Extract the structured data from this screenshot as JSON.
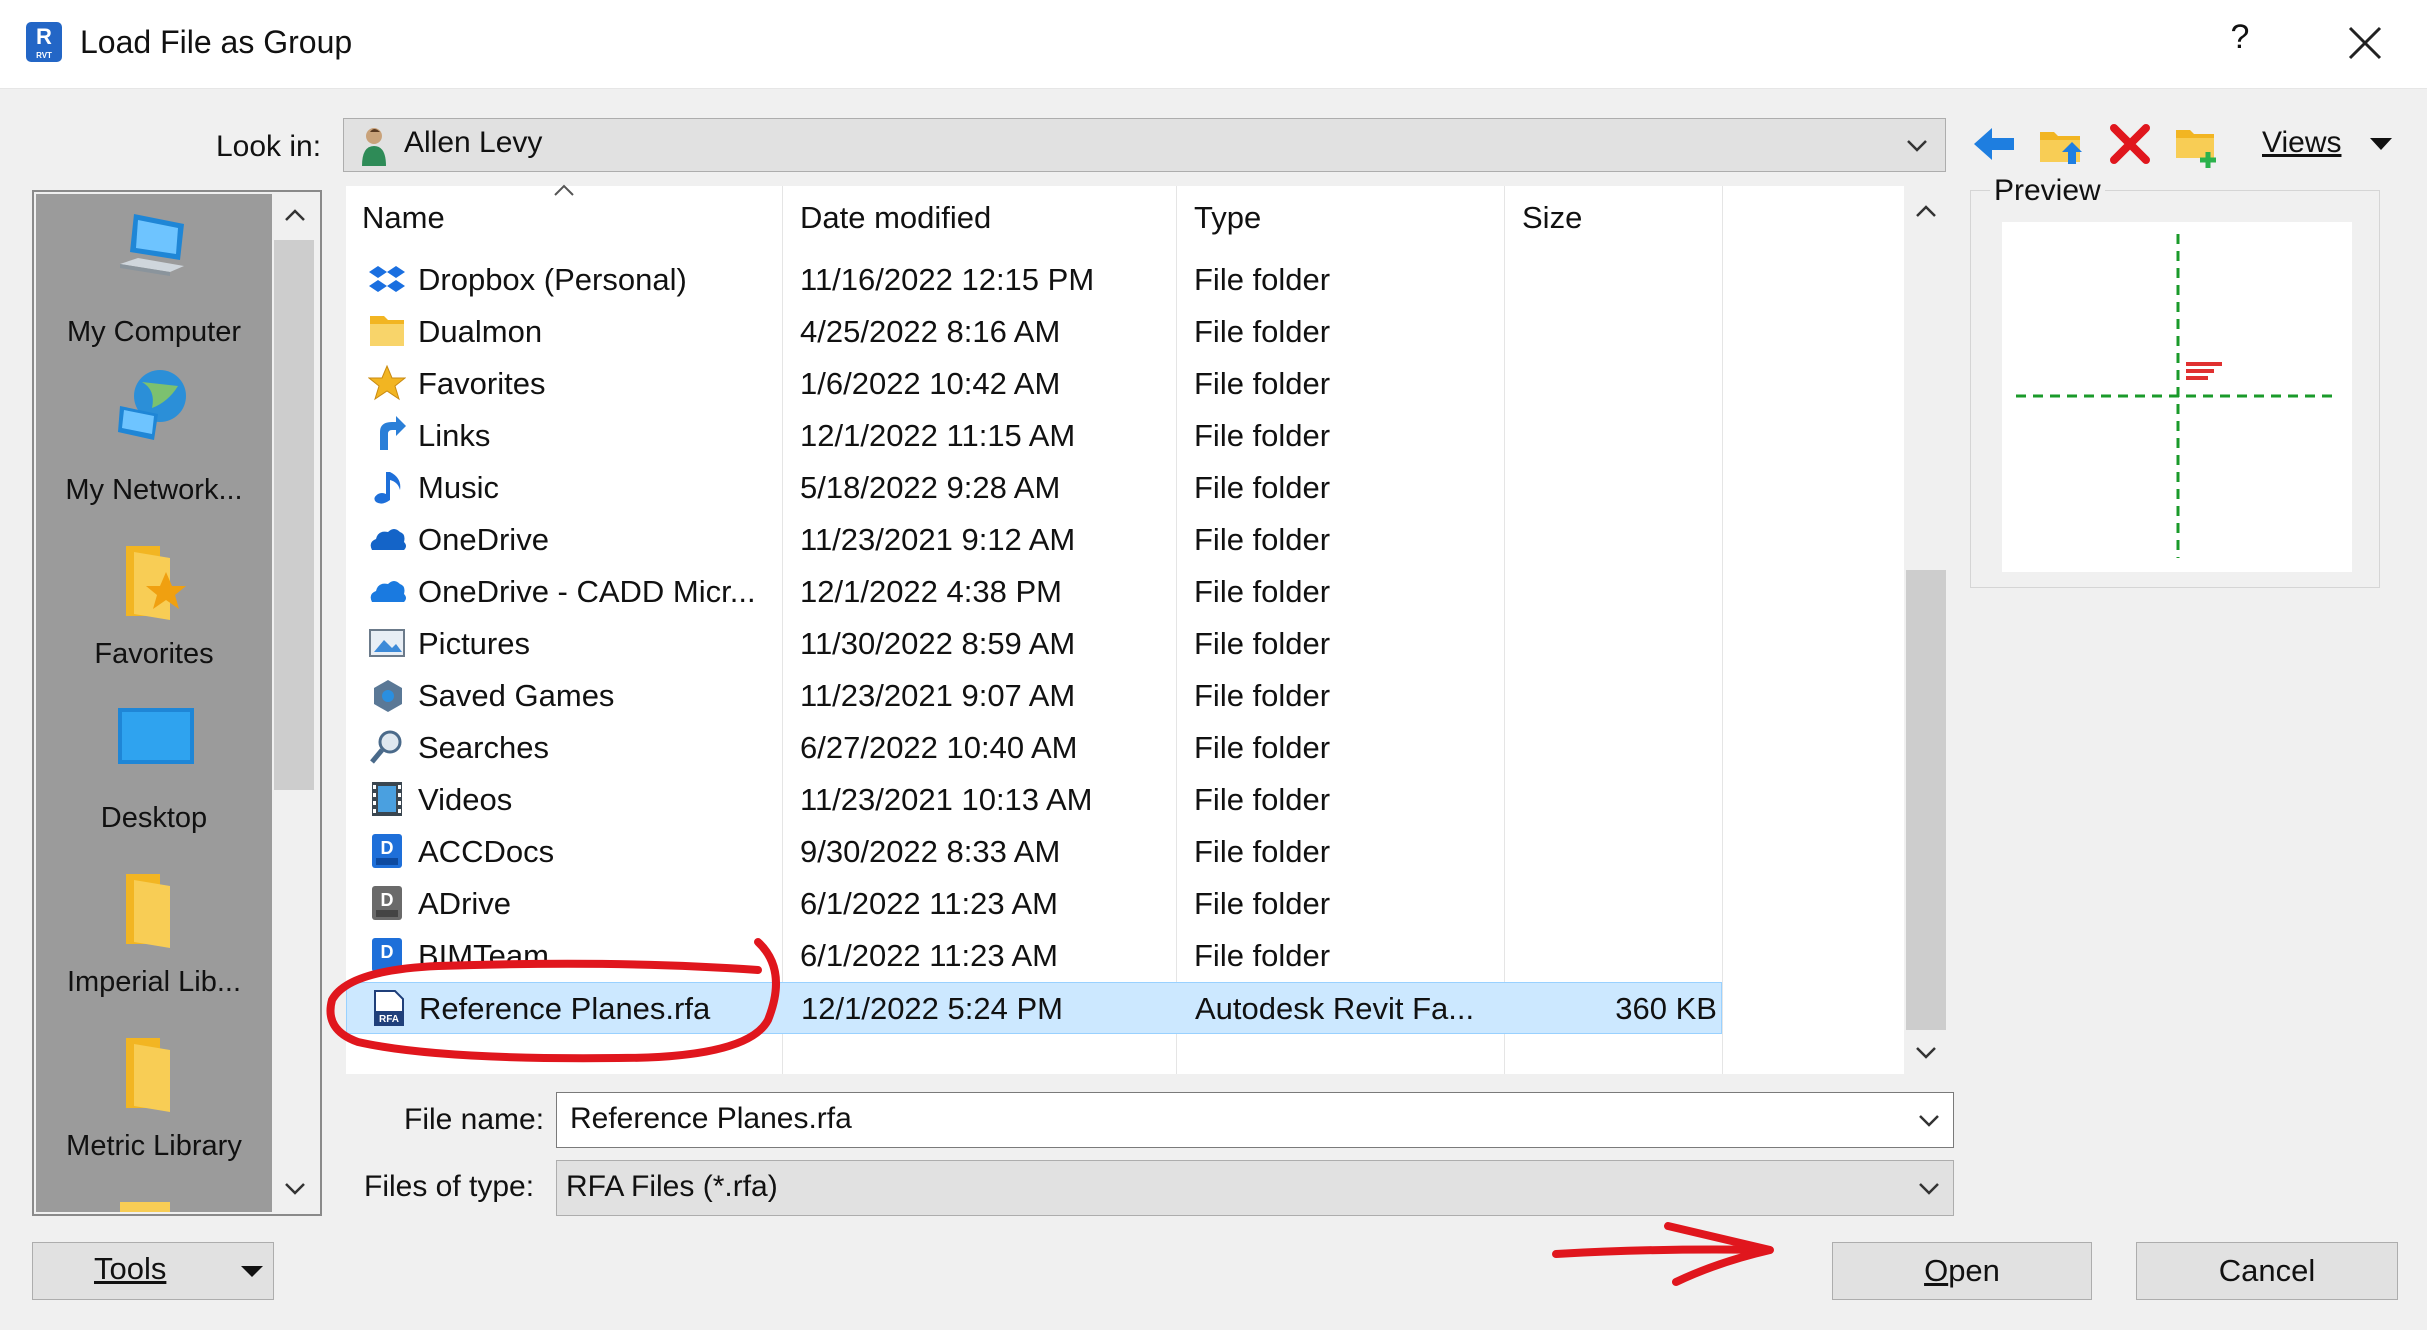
{
  "window": {
    "title": "Load File as Group",
    "app_icon_letter": "R",
    "app_icon_sub": "RVT",
    "help_label": "?",
    "close_icon": "close-icon"
  },
  "lookin": {
    "label": "Look in:",
    "value": "Allen Levy"
  },
  "toolbar": {
    "back_icon": "back-arrow-icon",
    "up_folder_icon": "up-one-level-icon",
    "delete_icon": "delete-icon",
    "new_folder_icon": "new-folder-icon",
    "views_label": "Views"
  },
  "places": [
    {
      "label": "My Computer",
      "icon": "computer-icon"
    },
    {
      "label": "My Network...",
      "icon": "network-icon"
    },
    {
      "label": "Favorites",
      "icon": "favorites-folder-icon"
    },
    {
      "label": "Desktop",
      "icon": "desktop-icon"
    },
    {
      "label": "Imperial Lib...",
      "icon": "folder-icon"
    },
    {
      "label": "Metric Library",
      "icon": "folder-icon"
    }
  ],
  "columns": {
    "name": "Name",
    "date": "Date modified",
    "type": "Type",
    "size": "Size"
  },
  "files": [
    {
      "name": "Dropbox (Personal)",
      "date": "11/16/2022 12:15 PM",
      "type": "File folder",
      "size": "",
      "icon": "dropbox-icon"
    },
    {
      "name": "Dualmon",
      "date": "4/25/2022 8:16 AM",
      "type": "File folder",
      "size": "",
      "icon": "folder-icon"
    },
    {
      "name": "Favorites",
      "date": "1/6/2022 10:42 AM",
      "type": "File folder",
      "size": "",
      "icon": "star-icon"
    },
    {
      "name": "Links",
      "date": "12/1/2022 11:15 AM",
      "type": "File folder",
      "size": "",
      "icon": "link-arrow-icon"
    },
    {
      "name": "Music",
      "date": "5/18/2022 9:28 AM",
      "type": "File folder",
      "size": "",
      "icon": "music-note-icon"
    },
    {
      "name": "OneDrive",
      "date": "11/23/2021 9:12 AM",
      "type": "File folder",
      "size": "",
      "icon": "onedrive-cloud-icon"
    },
    {
      "name": "OneDrive - CADD Micr...",
      "date": "12/1/2022 4:38 PM",
      "type": "File folder",
      "size": "",
      "icon": "onedrive-business-icon"
    },
    {
      "name": "Pictures",
      "date": "11/30/2022 8:59 AM",
      "type": "File folder",
      "size": "",
      "icon": "pictures-icon"
    },
    {
      "name": "Saved Games",
      "date": "11/23/2021 9:07 AM",
      "type": "File folder",
      "size": "",
      "icon": "saved-games-icon"
    },
    {
      "name": "Searches",
      "date": "6/27/2022 10:40 AM",
      "type": "File folder",
      "size": "",
      "icon": "search-icon"
    },
    {
      "name": "Videos",
      "date": "11/23/2021 10:13 AM",
      "type": "File folder",
      "size": "",
      "icon": "film-icon"
    },
    {
      "name": "ACCDocs",
      "date": "9/30/2022 8:33 AM",
      "type": "File folder",
      "size": "",
      "icon": "accdocs-drive-icon"
    },
    {
      "name": "ADrive",
      "date": "6/1/2022 11:23 AM",
      "type": "File folder",
      "size": "",
      "icon": "adrive-icon"
    },
    {
      "name": "BIMTeam",
      "date": "6/1/2022 11:23 AM",
      "type": "File folder",
      "size": "",
      "icon": "bimteam-drive-icon"
    },
    {
      "name": "Reference Planes.rfa",
      "date": "12/1/2022 5:24 PM",
      "type": "Autodesk Revit Fa...",
      "size": "360 KB",
      "icon": "rfa-file-icon",
      "selected": true
    }
  ],
  "preview": {
    "label": "Preview"
  },
  "filename": {
    "label": "File name:",
    "value": "Reference Planes.rfa"
  },
  "filetype": {
    "label": "Files of type:",
    "value": "RFA Files  (*.rfa)"
  },
  "buttons": {
    "tools": "Tools",
    "open": "Open",
    "cancel": "Cancel"
  },
  "colors": {
    "selection": "#cce8ff",
    "annotation": "#e0161d",
    "accent": "#1e6fd9"
  }
}
